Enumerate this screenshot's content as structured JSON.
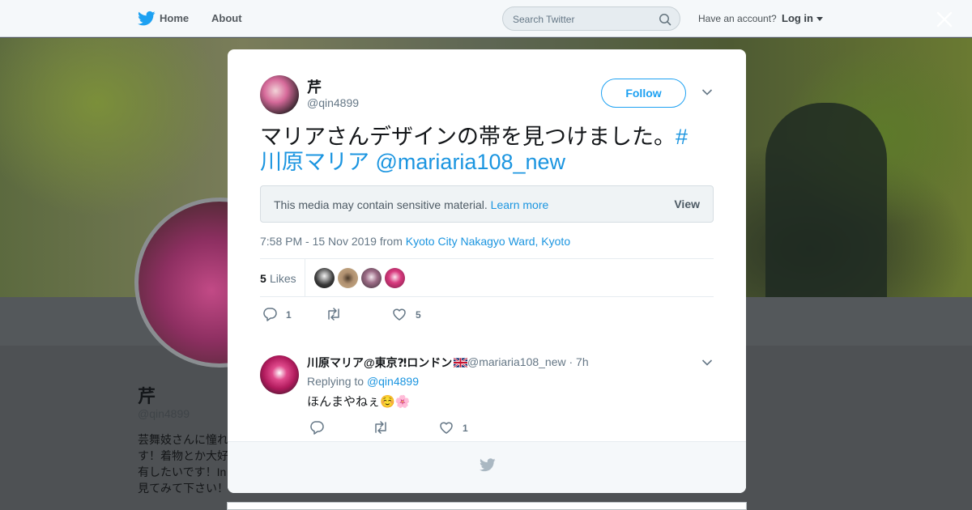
{
  "topbar": {
    "home_label": "Home",
    "about_label": "About",
    "search_placeholder": "Search Twitter",
    "account_question": "Have an account?",
    "login_label": "Log in"
  },
  "background_profile": {
    "name": "芹",
    "handle": "@qin4899",
    "bio_lines": [
      "芸舞妓さんに憧れ",
      "す！着物とか大好",
      "有したいです！In",
      "見てみて下さい！"
    ]
  },
  "tweet": {
    "author_name": "芹",
    "author_handle": "@qin4899",
    "follow_label": "Follow",
    "text_plain": "マリアさんデザインの帯を見つけました。",
    "hashtag_line1": "#",
    "hashtag_line2": "川原マリア",
    "mention": "@mariaria108_new",
    "sensitive_message": "This media may contain sensitive material.",
    "learn_more": "Learn more",
    "view_label": "View",
    "timestamp": "7:58 PM - 15 Nov 2019 from",
    "location": "Kyoto City Nakagyo Ward, Kyoto",
    "likes_count": "5",
    "likes_label": "Likes",
    "reply_count": "1",
    "like_count": "5"
  },
  "reply": {
    "name": "川原マリア@東京⁈ロンドン",
    "handle_time": "@mariaria108_new · 7h",
    "replying_label": "Replying to",
    "replying_to": "@qin4899",
    "text": "ほんまやねぇ☺️🌸",
    "like_count": "1"
  },
  "colors": {
    "accent": "#1da1f2",
    "link": "#1b95e0",
    "muted": "#657786"
  }
}
